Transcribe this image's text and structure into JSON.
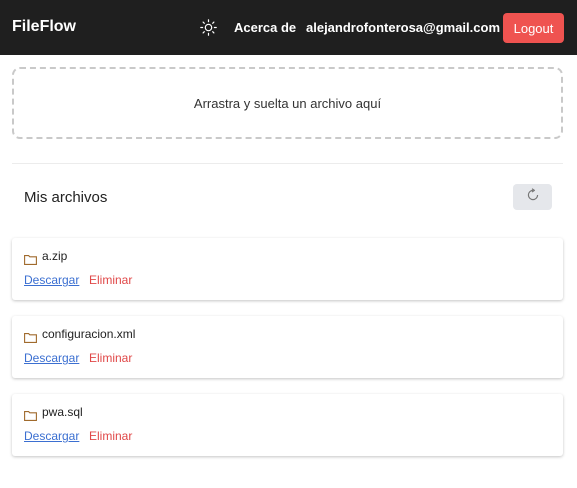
{
  "app": {
    "title": "FileFlow"
  },
  "nav": {
    "theme_icon": "sun-icon",
    "about_label": "Acerca de",
    "user_email": "alejandrofonterosa@gmail.com",
    "logout_label": "Logout"
  },
  "upload": {
    "prompt": "Arrastra y suelta un archivo aquí"
  },
  "files_section": {
    "title": "Mis archivos",
    "refresh_icon": "refresh-icon",
    "files": [
      {
        "name": "a.zip",
        "download_label": "Descargar",
        "delete_label": "Eliminar"
      },
      {
        "name": "configuracion.xml",
        "download_label": "Descargar",
        "delete_label": "Eliminar"
      },
      {
        "name": "pwa.sql",
        "download_label": "Descargar",
        "delete_label": "Eliminar"
      }
    ]
  },
  "colors": {
    "navbar_bg": "#1f1f1f",
    "logout_bg": "#ef5350",
    "link_blue": "#3b6fd1",
    "delete_red": "#e04848",
    "folder_brown": "#a06a2c"
  }
}
